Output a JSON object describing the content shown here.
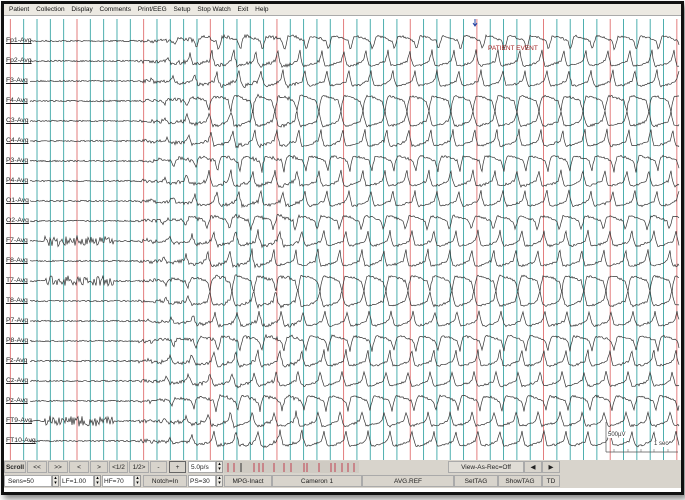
{
  "menu": [
    "Patient",
    "Collection",
    "Display",
    "Comments",
    "Print/EEG",
    "Setup",
    "Stop Watch",
    "Exit",
    "Help"
  ],
  "channels": [
    "Fp1-Avg",
    "Fp2-Avg",
    "F3-Avg",
    "F4-Avg",
    "C3-Avg",
    "C4-Avg",
    "P3-Avg",
    "P4-Avg",
    "O1-Avg",
    "O2-Avg",
    "F7-Avg",
    "F8-Avg",
    "T7-Avg",
    "T8-Avg",
    "P7-Avg",
    "P8-Avg",
    "Fz-Avg",
    "Cz-Avg",
    "Pz-Avg",
    "FT9-Avg",
    "FT10-Avg"
  ],
  "event_label": "PATIENT EVENT",
  "scale": {
    "amplitude": "500µV",
    "time": "1 sec"
  },
  "toolbar1": {
    "scroll": "Scroll",
    "first": "<<",
    "last": ">>",
    "prev": "<",
    "next": ">",
    "prev_half": "<1/2",
    "next_half": "1/2>",
    "minus": "-",
    "plus": "+",
    "speed": "5.0p/s",
    "view_as_rec": "View-As-Rec=Off",
    "left": "◀",
    "right": "▶"
  },
  "toolbar2": {
    "sens": "Sens=50",
    "lf": "LF=1.00",
    "hf": "HF=70",
    "notch": "Notch=In",
    "ps": "PS=30",
    "mpg": "MPG-Inact",
    "camera": "Cameron 1",
    "montage": "AVG.REF",
    "settag": "SetTAG",
    "showtag": "ShowTAG",
    "td": "TD"
  },
  "colors": {
    "grid_teal": "#3aa6a6",
    "grid_red": "#e07070",
    "trace": "#333333",
    "event": "#a02020"
  }
}
